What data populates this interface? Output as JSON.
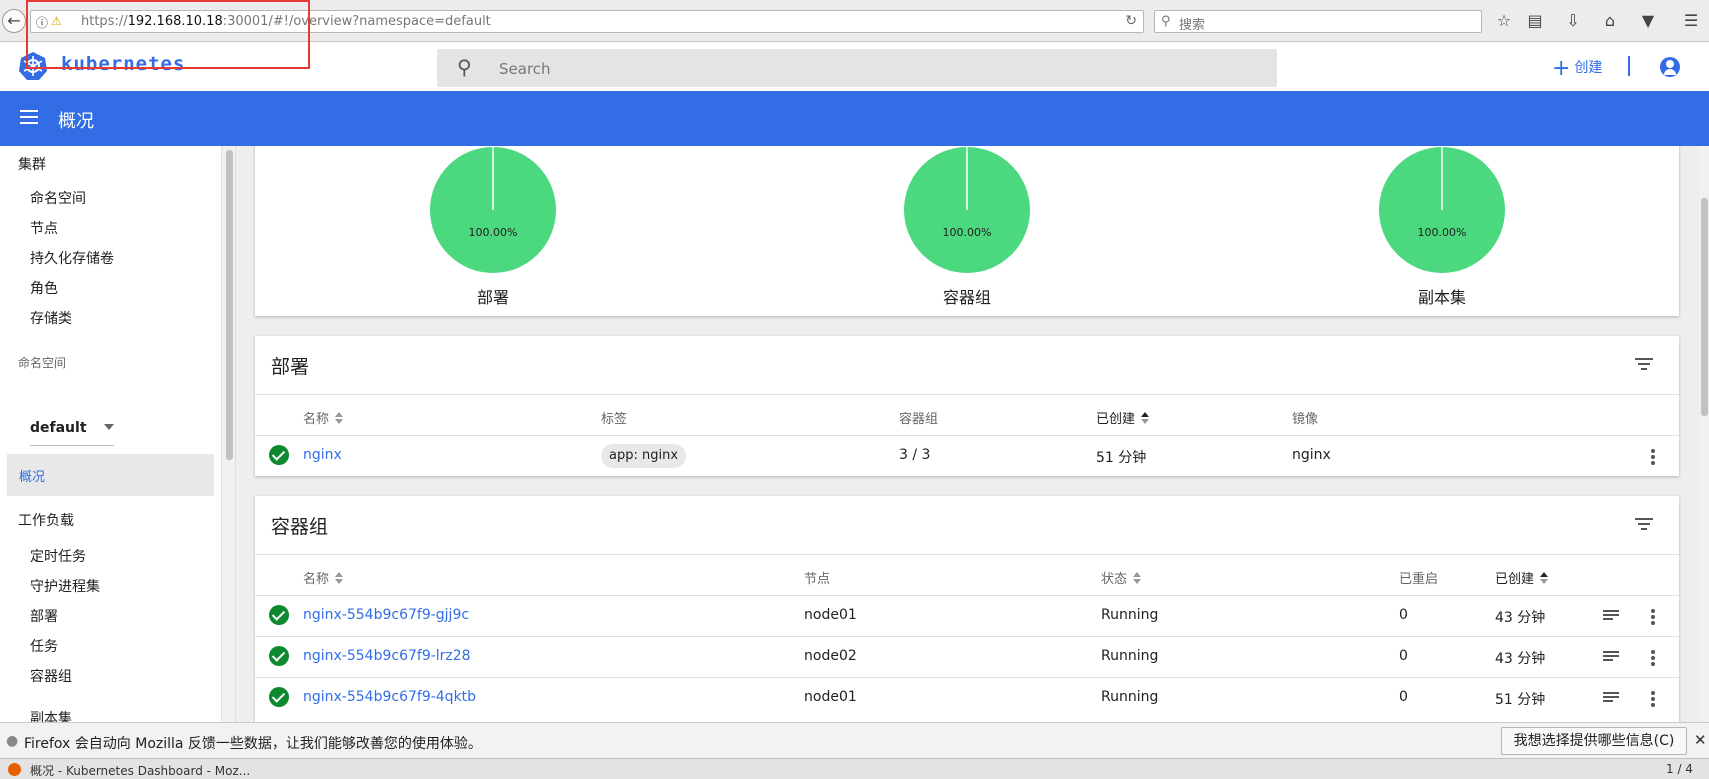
{
  "browser": {
    "url_prefix": "https://",
    "url_host": "192.168.10.18",
    "url_rest": ":30001/#!/overview?namespace=default",
    "search_placeholder": "搜索"
  },
  "app": {
    "logo_text": "kubernetes",
    "search_placeholder": "Search",
    "create_label": "创建",
    "header_title": "概况"
  },
  "sidebar": {
    "cluster_heading": "集群",
    "cluster_items": [
      "命名空间",
      "节点",
      "持久化存储卷",
      "角色",
      "存储类"
    ],
    "namespace_label": "命名空间",
    "namespace_value": "default",
    "active_item": "概况",
    "workloads_heading": "工作负载",
    "workload_items": [
      "定时任务",
      "守护进程集",
      "部署",
      "任务",
      "容器组",
      "副本集"
    ]
  },
  "status_pies": [
    {
      "label": "部署",
      "percent": "100.00%",
      "value": 100
    },
    {
      "label": "容器组",
      "percent": "100.00%",
      "value": 100
    },
    {
      "label": "副本集",
      "percent": "100.00%",
      "value": 100
    }
  ],
  "colors": {
    "accent": "#326de6",
    "pie_fill": "#4cd87f",
    "success": "#0d8a2e"
  },
  "deployments": {
    "title": "部署",
    "headers": {
      "name": "名称",
      "labels": "标签",
      "pods": "容器组",
      "created": "已创建",
      "images": "镜像"
    },
    "rows": [
      {
        "name": "nginx",
        "label": "app: nginx",
        "pods": "3 / 3",
        "created": "51 分钟",
        "image": "nginx"
      }
    ]
  },
  "pods": {
    "title": "容器组",
    "headers": {
      "name": "名称",
      "node": "节点",
      "status": "状态",
      "restarts": "已重启",
      "created": "已创建"
    },
    "rows": [
      {
        "name": "nginx-554b9c67f9-gjj9c",
        "node": "node01",
        "status": "Running",
        "restarts": "0",
        "created": "43 分钟"
      },
      {
        "name": "nginx-554b9c67f9-lrz28",
        "node": "node02",
        "status": "Running",
        "restarts": "0",
        "created": "43 分钟"
      },
      {
        "name": "nginx-554b9c67f9-4qktb",
        "node": "node01",
        "status": "Running",
        "restarts": "0",
        "created": "51 分钟"
      }
    ]
  },
  "notification": {
    "message": "Firefox 会自动向 Mozilla 反馈一些数据，让我们能够改善您的使用体验。",
    "button": "我想选择提供哪些信息(C)"
  },
  "taskbar": {
    "window_title": "概况 - Kubernetes Dashboard - Moz...",
    "page": "1 / 4"
  }
}
